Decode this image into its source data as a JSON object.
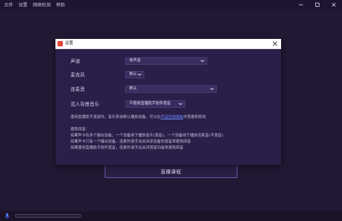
{
  "menu": [
    "文件",
    "设置",
    "网络检测",
    "帮助"
  ],
  "main": {
    "live_button_label": "直播课程"
  },
  "dialog": {
    "title": "设置",
    "channel": {
      "label": "声道",
      "value": "单声道"
    },
    "microphone": {
      "label": "麦克风",
      "value": "默认"
    },
    "speaker": {
      "label": "连麦音",
      "value": "默认"
    },
    "bg_music": {
      "label": "混入背景音乐",
      "value": "不使用直播助手软件混音"
    },
    "hint": {
      "prefix": "使用直播助手混音时，音乐来自默认播放设备，可以在",
      "link": "声音控制面板",
      "suffix": "中查看和修改"
    },
    "echo": {
      "title": "避免回音：",
      "lines": [
        "如果声卡有多个输出设备，一个设备用于播放音乐(混音)，一个设备用于播放连麦音(不混音)",
        "如果声卡只有一个输出设备，连麦时请手动关闭该设备的混音来避免回音",
        "如果使用直播助手软件混音，连麦时请手动关闭混音功能来避免回音"
      ]
    }
  },
  "icons": {
    "minimize": "minimize-icon",
    "maximize": "maximize-icon",
    "close": "close-icon",
    "mic": "microphone-icon"
  },
  "colors": {
    "app_bg": "#221935",
    "dialog_bg": "#2b1e48",
    "accent": "#7b59b6",
    "link": "#6c8cff"
  }
}
